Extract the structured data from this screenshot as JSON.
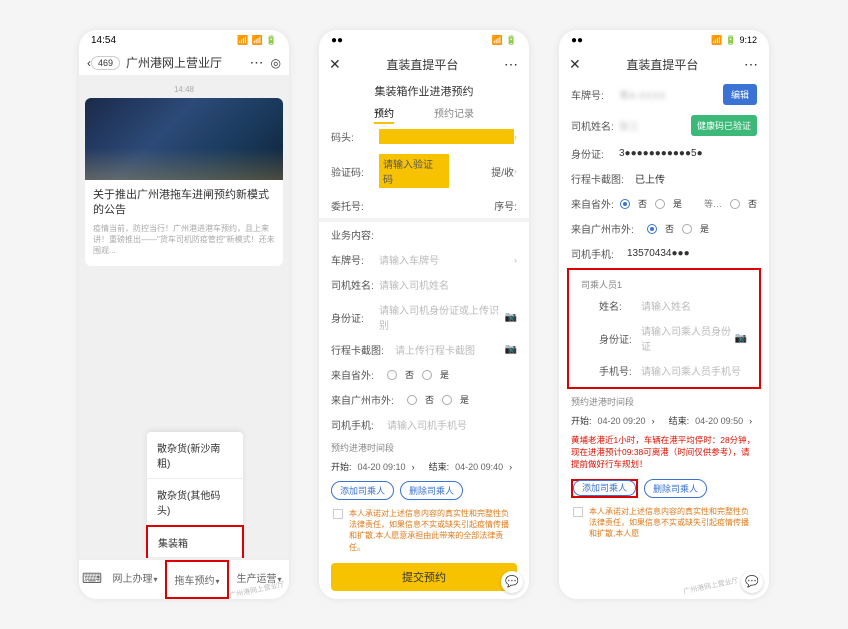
{
  "phone1": {
    "status_time": "14:54",
    "nav_back_count": "469",
    "nav_title": "广州港网上营业厅",
    "msg_time": "14:48",
    "card_title": "关于推出广州港拖车进闸预约新模式的公告",
    "card_desc": "疫情当前，防控当行！广州港进港车预约，且上来讲！重磅推出——\"货车司机防疫管控\"新模式！还未围观...",
    "popup": {
      "item1": "散杂货(新沙南粗)",
      "item2": "散杂货(其他码头)",
      "item3": "集装箱"
    },
    "bottom_tabs": {
      "tab1": "网上办理",
      "tab2": "拖车预约",
      "tab3": "生产运营"
    }
  },
  "phone2": {
    "nav_title": "直装直提平台",
    "subtitle": "集装箱作业进港预约",
    "tabs": {
      "reserve": "预约",
      "records": "预约记录"
    },
    "rows": {
      "dock": "码头:",
      "verify": "验证码:",
      "verify_ph": "请输入验证码",
      "verify_btn": "提/收",
      "entrust": "委托号:",
      "serial": "序号:",
      "biz": "业务内容:",
      "plate": "车牌号:",
      "plate_ph": "请输入车牌号",
      "driver": "司机姓名:",
      "driver_ph": "请输入司机姓名",
      "idcard": "身份证:",
      "idcard_ph": "请输入司机身份证或上传识别",
      "tripcard": "行程卡截图:",
      "tripcard_ph": "请上传行程卡截图",
      "from_prov": "来自省外:",
      "from_city": "来自广州市外:",
      "opt_no": "否",
      "opt_yes": "是",
      "driver_phone": "司机手机:",
      "driver_phone_ph": "请输入司机手机号"
    },
    "time_label": "预约进港时间段",
    "start_label": "开始:",
    "start_val": "04-20 09:10",
    "end_label": "结束:",
    "end_val": "04-20 09:40",
    "pills": {
      "add": "添加司乘人",
      "del": "删除司乘人"
    },
    "disclaimer": "本人承诺对上述信息内容的真实性和完整性负法律责任，如果信息不实或缺失引起疫情传播和扩散,本人愿意承担由此带来的全部法律责任。",
    "submit": "提交预约"
  },
  "phone3": {
    "status_time": "9:12",
    "nav_title": "直装直提平台",
    "rows": {
      "plate": "车牌号:",
      "driver": "司机姓名:",
      "green_btn": "健康码已验证",
      "idcard": "身份证:",
      "idcard_val": "3●●●●●●●●●●●5●",
      "tripcard": "行程卡截图:",
      "tripcard_val": "已上传",
      "from_prov": "来自省外:",
      "from_city": "来自广州市外:",
      "opt_no": "否",
      "opt_no2": "否",
      "opt_yes": "是",
      "cityopt_no": "否",
      "cityopt_yes": "是",
      "driver_phone": "司机手机:",
      "driver_phone_val": "13570434●●●",
      "passenger_header": "司乘人员1",
      "p_name": "姓名:",
      "p_name_ph": "请输入姓名",
      "p_id": "身份证:",
      "p_id_ph": "请输入司乘人员身份证",
      "p_phone": "手机号:",
      "p_phone_ph": "请输入司乘人员手机号"
    },
    "edit_btn": "编辑",
    "time_label": "预约进港时间段",
    "start_label": "开始:",
    "start_val": "04-20 09:20",
    "end_label": "结束:",
    "end_val": "04-20 09:50",
    "red_notice": "黄埔老港近1小时，车辆在港平均停时：28分钟，现在进港预计09:38可离港（时间仅供参考），请提前做好行车规划！",
    "pills": {
      "add": "添加司乘人",
      "del": "删除司乘人"
    },
    "disclaimer": "本人承诺对上述信息内容的真实性和完整性负法律责任，如果信息不实或缺失引起疫情传播和扩散,本人愿",
    "watermark": "广州港网上营业厅"
  }
}
